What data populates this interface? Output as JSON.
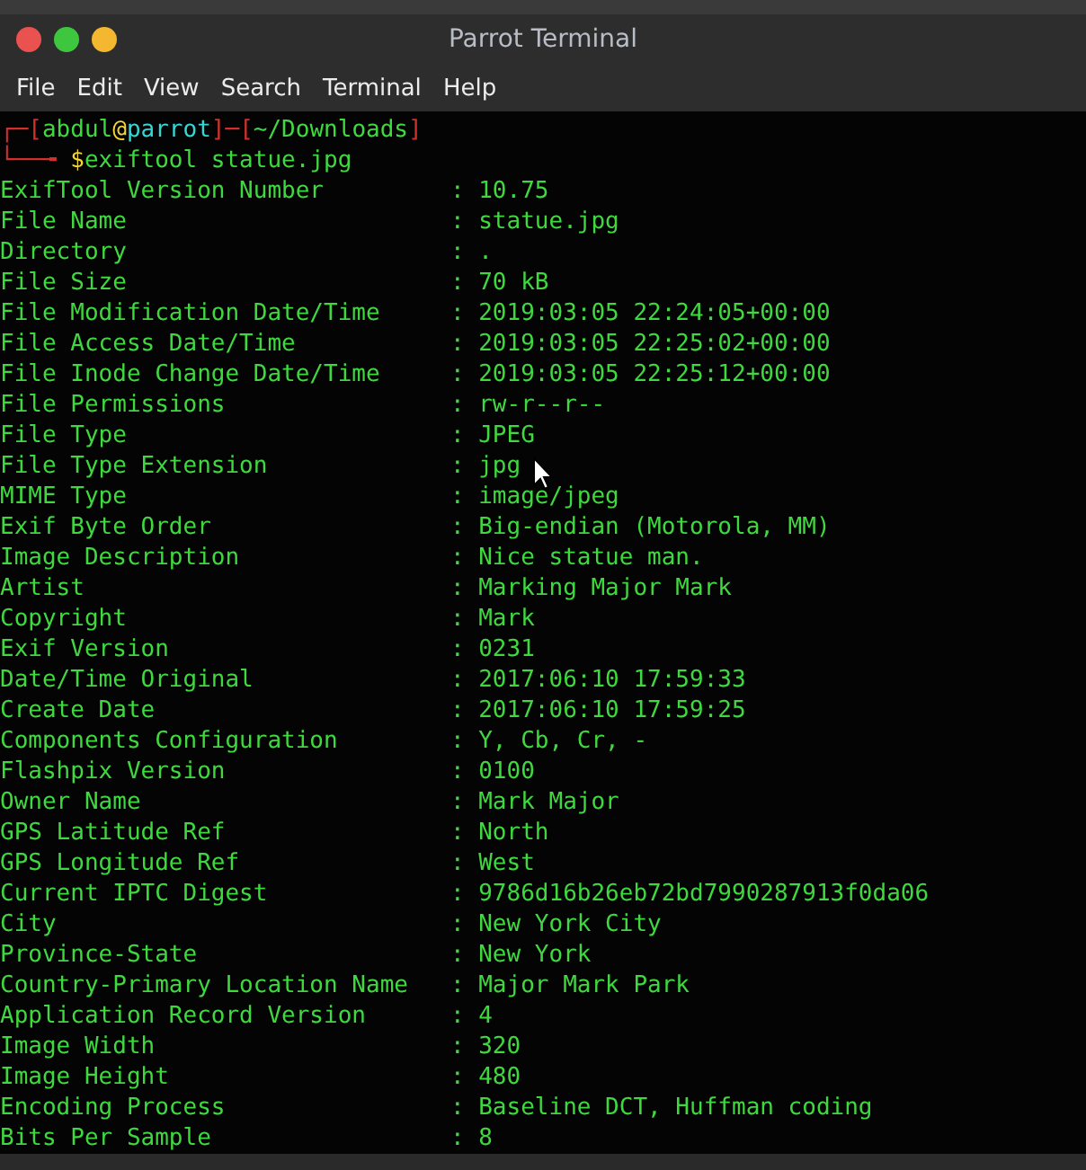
{
  "window": {
    "title": "Parrot Terminal",
    "buttons": [
      {
        "color": "#e9524f"
      },
      {
        "color": "#3ec73e"
      },
      {
        "color": "#f4b830"
      }
    ]
  },
  "menu": [
    "File",
    "Edit",
    "View",
    "Search",
    "Terminal",
    "Help"
  ],
  "prompt": [
    [
      {
        "kind": "frame",
        "text": "┌─["
      },
      {
        "kind": "user",
        "text": "abdul"
      },
      {
        "kind": "at",
        "text": "@"
      },
      {
        "kind": "host",
        "text": "parrot"
      },
      {
        "kind": "frame",
        "text": "]─["
      },
      {
        "kind": "path",
        "text": "~/Downloads"
      },
      {
        "kind": "frame",
        "text": "]"
      }
    ],
    [
      {
        "kind": "frame",
        "text": "└──╼ "
      },
      {
        "kind": "at",
        "text": "$"
      },
      {
        "kind": "command",
        "text": "exiftool statue.jpg"
      }
    ]
  ],
  "output": [
    "ExifTool Version Number         : 10.75",
    "File Name                       : statue.jpg",
    "Directory                       : .",
    "File Size                       : 70 kB",
    "File Modification Date/Time     : 2019:03:05 22:24:05+00:00",
    "File Access Date/Time           : 2019:03:05 22:25:02+00:00",
    "File Inode Change Date/Time     : 2019:03:05 22:25:12+00:00",
    "File Permissions                : rw-r--r--",
    "File Type                       : JPEG",
    "File Type Extension             : jpg",
    "MIME Type                       : image/jpeg",
    "Exif Byte Order                 : Big-endian (Motorola, MM)",
    "Image Description               : Nice statue man.",
    "Artist                          : Marking Major Mark",
    "Copyright                       : Mark",
    "Exif Version                    : 0231",
    "Date/Time Original              : 2017:06:10 17:59:33",
    "Create Date                     : 2017:06:10 17:59:25",
    "Components Configuration        : Y, Cb, Cr, -",
    "Flashpix Version                : 0100",
    "Owner Name                      : Mark Major",
    "GPS Latitude Ref                : North",
    "GPS Longitude Ref               : West",
    "Current IPTC Digest             : 9786d16b26eb72bd7990287913f0da06",
    "City                            : New York City",
    "Province-State                  : New York",
    "Country-Primary Location Name   : Major Mark Park",
    "Application Record Version      : 4",
    "Image Width                     : 320",
    "Image Height                    : 480",
    "Encoding Process                : Baseline DCT, Huffman coding",
    "Bits Per Sample                 : 8"
  ]
}
